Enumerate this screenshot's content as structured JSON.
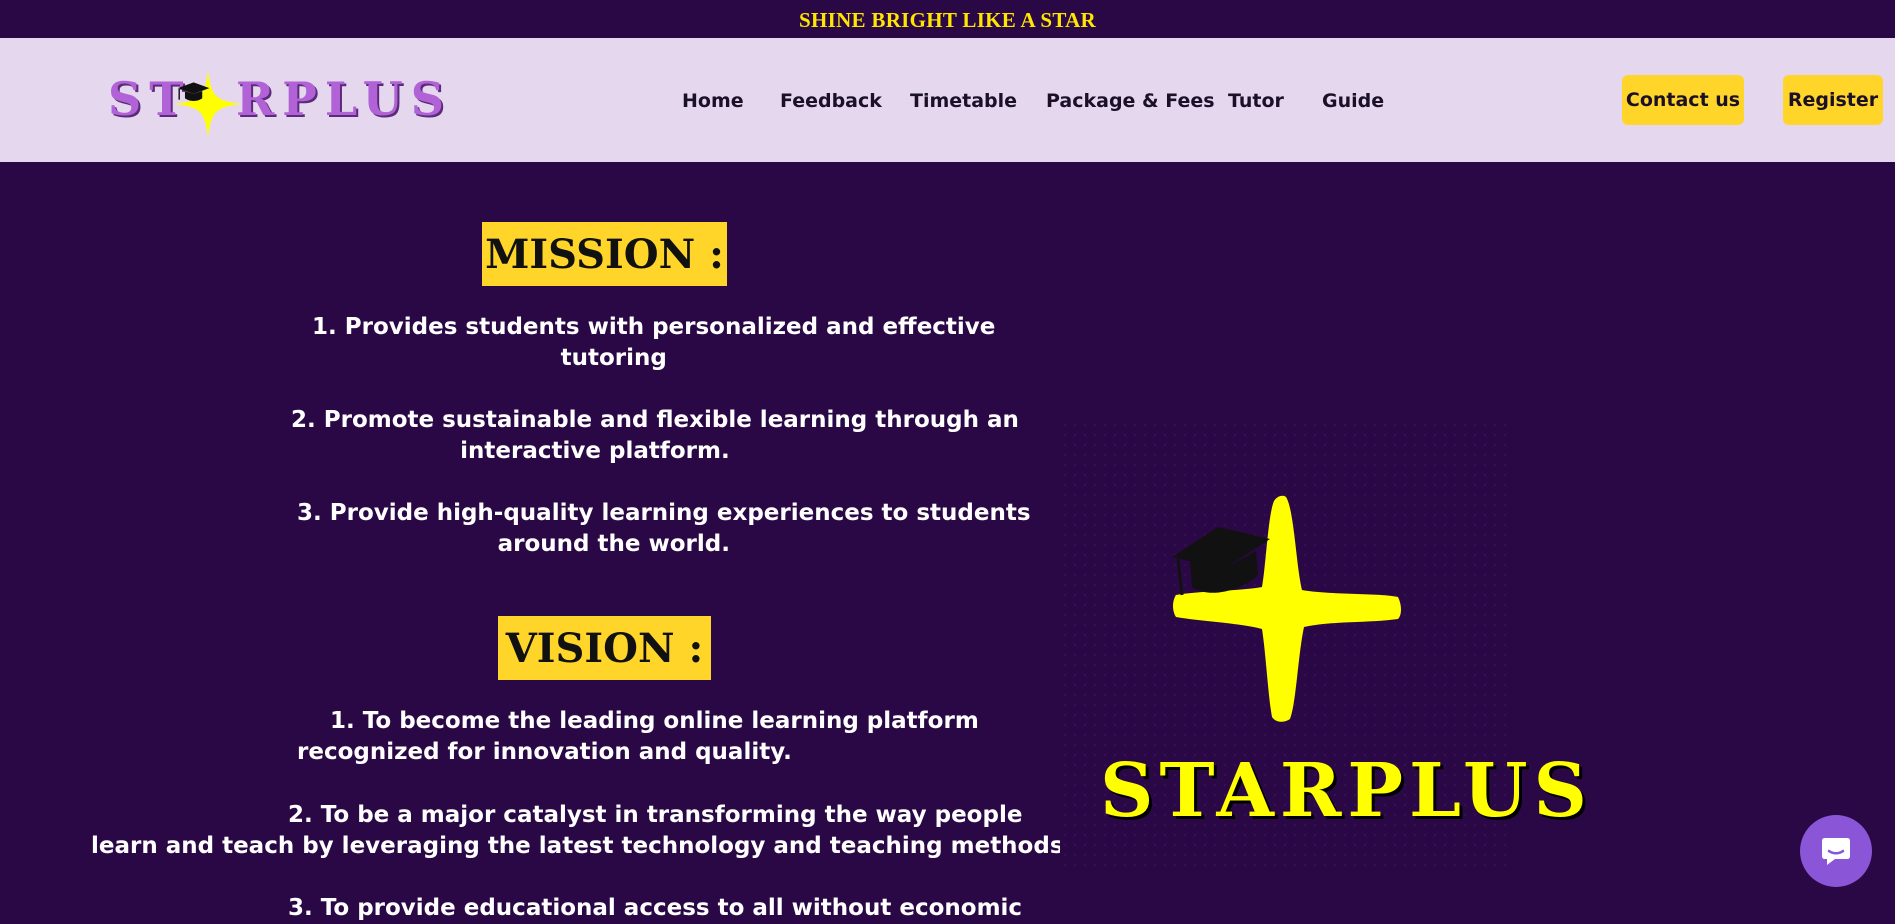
{
  "banner": {
    "text": "SHINE BRIGHT LIKE A STAR"
  },
  "logo": {
    "text_left": "ST",
    "text_right": "RPLUS"
  },
  "nav": {
    "items": [
      {
        "label": "Home"
      },
      {
        "label": "Feedback"
      },
      {
        "label": "Timetable"
      },
      {
        "label": "Package & Fees"
      },
      {
        "label": "Tutor"
      },
      {
        "label": "Guide"
      }
    ]
  },
  "actions": {
    "contact_label": "Contact us",
    "register_label": "Register"
  },
  "mission": {
    "title": "MISSION :",
    "items": [
      {
        "line1": "1. Provides students with personalized and effective",
        "line2": "tutoring"
      },
      {
        "line1": "2. Promote sustainable and flexible learning through an",
        "line2": "interactive platform."
      },
      {
        "line1": "3. Provide high-quality learning experiences to students",
        "line2": "around the world."
      }
    ]
  },
  "vision": {
    "title": "VISION :",
    "items": [
      {
        "line1": "1. To become the leading online learning platform",
        "line2": "recognized for innovation and quality."
      },
      {
        "line1": "2. To be a major catalyst in transforming the way people",
        "line2": "learn and teach by leveraging the latest technology and teaching methods."
      },
      {
        "line1": "3. To provide educational access to all without economic",
        "line2": ""
      }
    ]
  },
  "hero_logo": {
    "text": "STARPLUS"
  },
  "colors": {
    "background": "#2a0845",
    "header": "#e4d7ee",
    "accent": "#ffd52a",
    "star": "#ffff00",
    "chat": "#8a55d6"
  },
  "icons": {
    "logo": "star-with-graduation-cap-icon",
    "chat": "chat-bubble-icon"
  }
}
